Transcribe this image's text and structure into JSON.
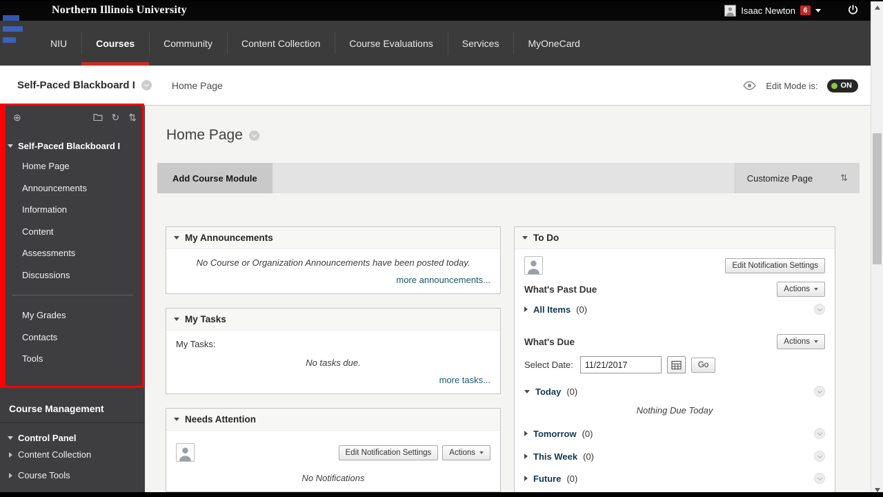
{
  "colors": {
    "nav_active_underline": "#cb2b24",
    "annotation_highlight": "#fb0006",
    "edit_mode_on_dot": "#8dc63f",
    "notification_badge": "#c3272b",
    "section_link": "#123a52",
    "more_link": "#19576f"
  },
  "header": {
    "university_title": "Northern Illinois University",
    "user_name": "Isaac Newton",
    "notification_count": "6"
  },
  "nav": {
    "items": [
      {
        "label": "NIU",
        "active": false
      },
      {
        "label": "Courses",
        "active": true
      },
      {
        "label": "Community",
        "active": false
      },
      {
        "label": "Content Collection",
        "active": false
      },
      {
        "label": "Course Evaluations",
        "active": false
      },
      {
        "label": "Services",
        "active": false
      },
      {
        "label": "MyOneCard",
        "active": false
      }
    ]
  },
  "breadcrumb": {
    "course_name": "Self-Paced Blackboard I",
    "current_page": "Home Page",
    "edit_mode_label": "Edit Mode is:",
    "edit_mode_state": "ON"
  },
  "sidebar": {
    "course_title": "Self-Paced Blackboard I",
    "menu_primary": [
      "Home Page",
      "Announcements",
      "Information",
      "Content",
      "Assessments",
      "Discussions"
    ],
    "menu_secondary": [
      "My Grades",
      "Contacts",
      "Tools"
    ],
    "management_heading": "Course Management",
    "control_panel_label": "Control Panel",
    "control_panel_items": [
      "Content Collection",
      "Course Tools"
    ]
  },
  "main": {
    "page_title": "Home Page",
    "add_course_module_label": "Add Course Module",
    "customize_page_label": "Customize Page"
  },
  "modules": {
    "announcements": {
      "title": "My Announcements",
      "empty_text": "No Course or Organization Announcements have been posted today.",
      "more_link": "more announcements..."
    },
    "tasks": {
      "title": "My Tasks",
      "list_label": "My Tasks:",
      "empty_text": "No tasks due.",
      "more_link": "more tasks..."
    },
    "needs_attention": {
      "title": "Needs Attention",
      "edit_notifications_label": "Edit Notification Settings",
      "actions_label": "Actions",
      "empty_text": "No Notifications"
    },
    "todo": {
      "title": "To Do",
      "edit_notifications_label": "Edit Notification Settings",
      "actions_label": "Actions",
      "whats_past_due_label": "What's Past Due",
      "all_items_label": "All Items",
      "all_items_count": "(0)",
      "whats_due_label": "What's Due",
      "select_date_label": "Select Date:",
      "date_value": "11/21/2017",
      "go_label": "Go",
      "nothing_due_text": "Nothing Due Today",
      "sections": [
        {
          "label": "Today",
          "count": "(0)"
        },
        {
          "label": "Tomorrow",
          "count": "(0)"
        },
        {
          "label": "This Week",
          "count": "(0)"
        },
        {
          "label": "Future",
          "count": "(0)"
        }
      ]
    }
  }
}
